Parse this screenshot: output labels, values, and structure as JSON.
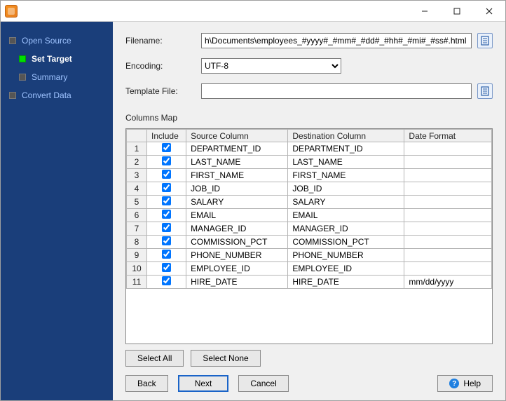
{
  "window": {
    "minimize": "—",
    "maximize": "□",
    "close": "✕"
  },
  "sidebar": {
    "steps": [
      {
        "label": "Open Source"
      },
      {
        "label": "Set Target"
      },
      {
        "label": "Summary"
      },
      {
        "label": "Convert Data"
      }
    ]
  },
  "form": {
    "filename_label": "Filename:",
    "filename_value": "h\\Documents\\employees_#yyyy#_#mm#_#dd#_#hh#_#mi#_#ss#.html",
    "encoding_label": "Encoding:",
    "encoding_value": "UTF-8",
    "template_label": "Template File:",
    "template_value": ""
  },
  "columns_map_label": "Columns Map",
  "grid": {
    "headers": {
      "rownum": "",
      "include": "Include",
      "source": "Source Column",
      "dest": "Destination Column",
      "date": "Date Format"
    },
    "rows": [
      {
        "n": "1",
        "include": true,
        "source": "DEPARTMENT_ID",
        "dest": "DEPARTMENT_ID",
        "date": ""
      },
      {
        "n": "2",
        "include": true,
        "source": "LAST_NAME",
        "dest": "LAST_NAME",
        "date": ""
      },
      {
        "n": "3",
        "include": true,
        "source": "FIRST_NAME",
        "dest": "FIRST_NAME",
        "date": ""
      },
      {
        "n": "4",
        "include": true,
        "source": "JOB_ID",
        "dest": "JOB_ID",
        "date": ""
      },
      {
        "n": "5",
        "include": true,
        "source": "SALARY",
        "dest": "SALARY",
        "date": ""
      },
      {
        "n": "6",
        "include": true,
        "source": "EMAIL",
        "dest": "EMAIL",
        "date": ""
      },
      {
        "n": "7",
        "include": true,
        "source": "MANAGER_ID",
        "dest": "MANAGER_ID",
        "date": ""
      },
      {
        "n": "8",
        "include": true,
        "source": "COMMISSION_PCT",
        "dest": "COMMISSION_PCT",
        "date": ""
      },
      {
        "n": "9",
        "include": true,
        "source": "PHONE_NUMBER",
        "dest": "PHONE_NUMBER",
        "date": ""
      },
      {
        "n": "10",
        "include": true,
        "source": "EMPLOYEE_ID",
        "dest": "EMPLOYEE_ID",
        "date": ""
      },
      {
        "n": "11",
        "include": true,
        "source": "HIRE_DATE",
        "dest": "HIRE_DATE",
        "date": "mm/dd/yyyy"
      }
    ]
  },
  "buttons": {
    "select_all": "Select All",
    "select_none": "Select None",
    "back": "Back",
    "next": "Next",
    "cancel": "Cancel",
    "help": "Help"
  }
}
